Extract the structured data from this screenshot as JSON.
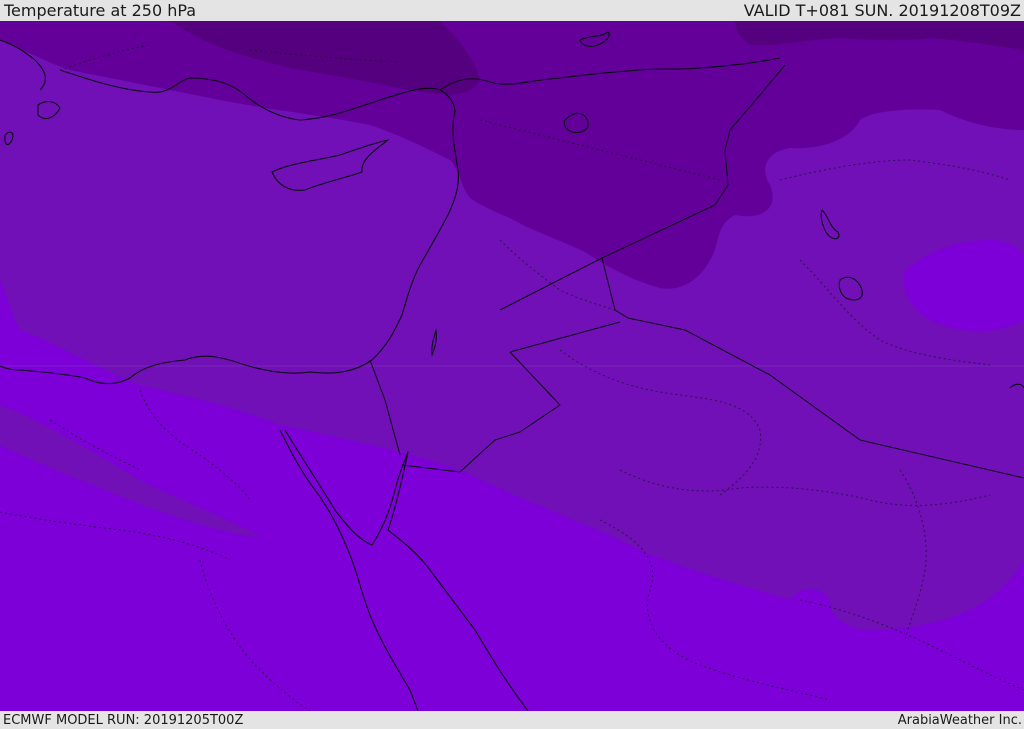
{
  "header": {
    "title": "Temperature at 250 hPa",
    "valid_time": "VALID T+081 SUN. 20191208T09Z"
  },
  "footer": {
    "model_run": "ECMWF MODEL RUN: 20191205T00Z",
    "credit": "ArabiaWeather Inc."
  },
  "map": {
    "variable": "temperature",
    "pressure_level_hpa": 250,
    "region": "Eastern Mediterranean / Middle East",
    "colors": {
      "band_coldest": "#55007f",
      "band_cold": "#63009a",
      "band_mid": "#7110b6",
      "band_warm": "#7d00d8",
      "coastline": "#0a0a14",
      "border": "#0a0a14"
    }
  }
}
